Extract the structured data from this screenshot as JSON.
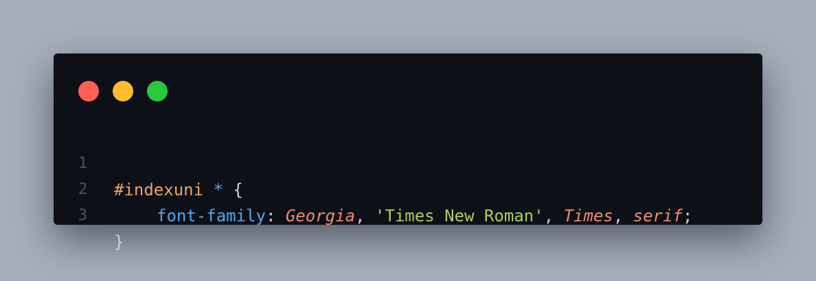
{
  "window": {
    "buttons": {
      "close_color": "#ff5f56",
      "minimize_color": "#ffbd2e",
      "maximize_color": "#27c93f"
    }
  },
  "editor": {
    "line_numbers": [
      "1",
      "2",
      "3"
    ],
    "colors": {
      "selector": "#f0a460",
      "universal": "#4fa6f0",
      "property": "#4fa6f0",
      "font_name": "#f08c6a",
      "string": "#a6d05a",
      "punctuation": "#d4d4d4"
    },
    "line1": {
      "selector": "#indexuni",
      "universal": "*",
      "brace_open": "{"
    },
    "line2": {
      "property": "font-family",
      "colon": ":",
      "value1": "Georgia",
      "comma1": ",",
      "value2": "'Times New Roman'",
      "comma2": ",",
      "value3": "Times",
      "comma3": ",",
      "value4": "serif",
      "semicolon": ";"
    },
    "line3": {
      "brace_close": "}"
    }
  }
}
